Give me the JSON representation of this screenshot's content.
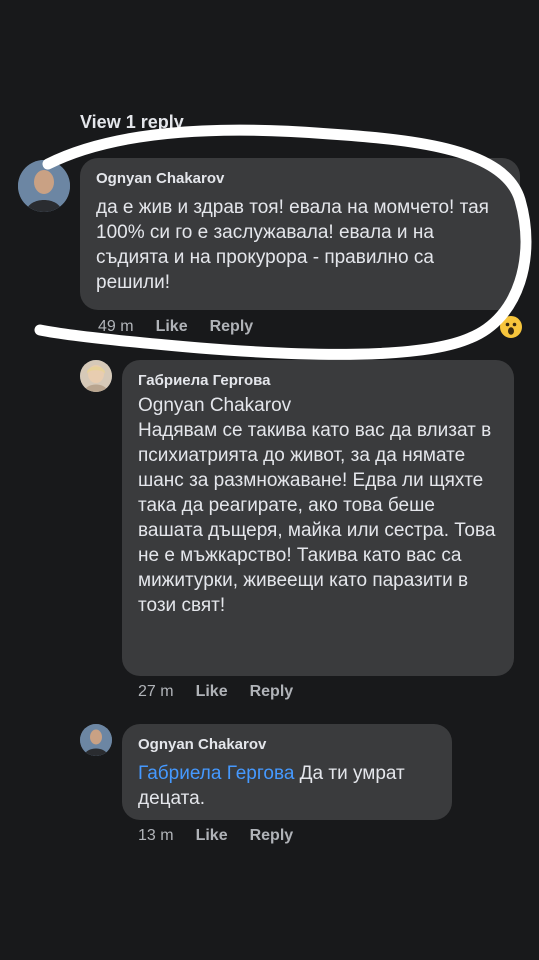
{
  "thread": {
    "view_reply_label": "View 1 reply"
  },
  "comments": [
    {
      "author": "Ognyan Chakarov",
      "text": "да е жив и здрав тоя! евала на момчето! тая 100% си го е заслужавала! евала и на съдията и на прокурора - правилно са решили!",
      "time": "49 m",
      "like_label": "Like",
      "reply_label": "Reply",
      "reaction_icon": "wow-reaction-icon"
    },
    {
      "author": "Габриела Гергова",
      "mention": "Ognyan Chakarov",
      "text": "Надявам се такива като вас да влизат в психиатрията до живот, за да нямате шанс за размножаване! Едва ли щяхте така да реагирате, ако това беше вашата дъщеря, майка или сестра. Това не е мъжкарство! Такива като вас са мижитурки, живеещи като паразити в този свят!",
      "time": "27 m",
      "like_label": "Like",
      "reply_label": "Reply"
    },
    {
      "author": "Ognyan Chakarov",
      "mention": "Габриела Гергова",
      "text": " Да ти умрат децата.",
      "time": "13 m",
      "like_label": "Like",
      "reply_label": "Reply"
    }
  ],
  "colors": {
    "background": "#18191b",
    "bubble": "#3a3b3d",
    "mention": "#4599ff",
    "meta": "#b0b3b8",
    "annotation": "#ffffff"
  }
}
